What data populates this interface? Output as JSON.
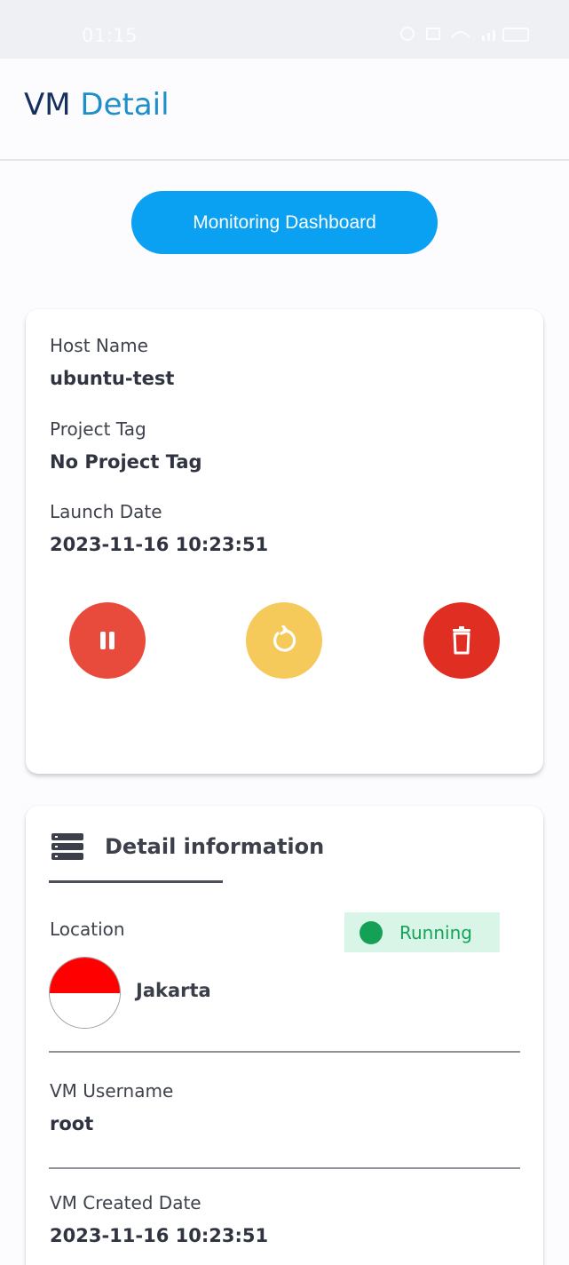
{
  "status_bar": {
    "time": "01:15"
  },
  "header": {
    "title_part1": "VM",
    "title_part2": "Detail"
  },
  "monitoring_button": "Monitoring Dashboard",
  "summary_card": {
    "host_name_label": "Host Name",
    "host_name_value": "ubuntu-test",
    "project_tag_label": "Project Tag",
    "project_tag_value": "No Project Tag",
    "launch_date_label": "Launch Date",
    "launch_date_value": "2023-11-16 10:23:51",
    "actions": [
      {
        "icon": "pause-icon",
        "color": "#e84b3c"
      },
      {
        "icon": "restart-icon",
        "color": "#f5ca5a"
      },
      {
        "icon": "trash-icon",
        "color": "#e02e22"
      }
    ]
  },
  "detail_card": {
    "section_title": "Detail information",
    "location_label": "Location",
    "location_value": "Jakarta",
    "status": "Running",
    "username_label": "VM Username",
    "username_value": "root",
    "created_label": "VM Created Date",
    "created_value": "2023-11-16 10:23:51"
  },
  "colors": {
    "primary_button": "#0aa1f3",
    "title_dark": "#15305e",
    "title_accent": "#1e8fc9",
    "running_green": "#14a155",
    "running_bg": "#d9f5e7"
  }
}
